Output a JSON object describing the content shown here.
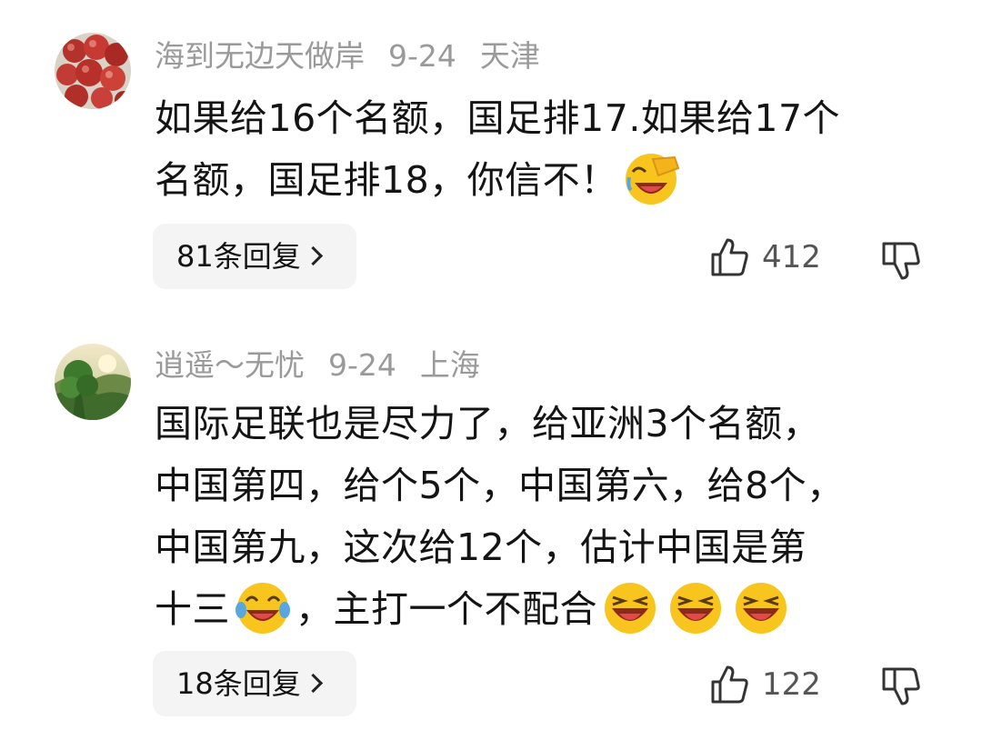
{
  "comments": [
    {
      "author": "海到无边天做岸",
      "date": "9-24",
      "location": "天津",
      "lines": [
        "如果给16个名额，国足排17.如果给17个",
        "名额，国足排18，你信不！"
      ],
      "emojis": [
        "facepalm-laugh-emoji"
      ],
      "replies_label": "81条回复",
      "likes": "412"
    },
    {
      "author": "逍遥～无忧",
      "date": "9-24",
      "location": "上海",
      "lines": [
        "国际足联也是尽力了，给亚洲3个名额，",
        "中国第四，给个5个，中国第六，给8个，",
        "中国第九，这次给12个，估计中国是第",
        "十三",
        "，主打一个不配合"
      ],
      "emojis": [
        "tears-of-joy-emoji",
        "grin-emoji",
        "grin-emoji",
        "grin-emoji"
      ],
      "replies_label": "18条回复",
      "likes": "122"
    }
  ],
  "icons": {
    "like": "thumbs-up-icon",
    "dislike": "thumbs-down-icon",
    "chevron": "chevron-right-icon"
  },
  "colors": {
    "meta_text": "#9a9a9a",
    "reply_bg": "#f4f4f4",
    "emoji_yellow": "#f7c51e"
  }
}
